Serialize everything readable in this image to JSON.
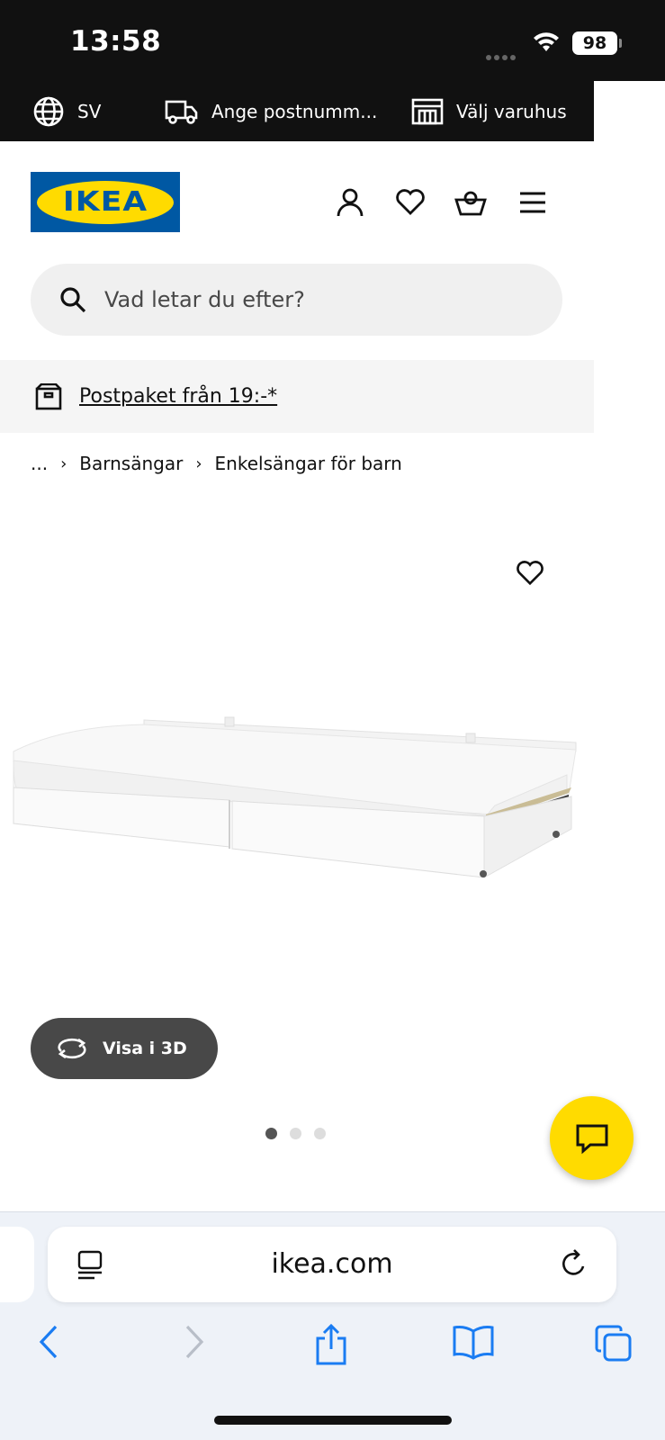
{
  "status_bar": {
    "time": "13:58",
    "battery": "98"
  },
  "util_bar": {
    "language": "SV",
    "zip": "Ange postnumm...",
    "store": "Välj varuhus"
  },
  "header": {
    "logo_text": "IKEA"
  },
  "search": {
    "placeholder": "Vad letar du efter?"
  },
  "promo": {
    "text": "Postpaket från 19:-*"
  },
  "breadcrumb": {
    "ellipsis": "...",
    "items": [
      "Barnsängar",
      "Enkelsängar för barn"
    ]
  },
  "product": {
    "view3d_label": "Visa i 3D",
    "gallery_count": 3,
    "gallery_active": 1
  },
  "browser": {
    "url": "ikea.com"
  },
  "colors": {
    "ikea_blue": "#0058a3",
    "ikea_yellow": "#ffdb00",
    "dark": "#111111",
    "safari_blue": "#1a7cf2"
  }
}
